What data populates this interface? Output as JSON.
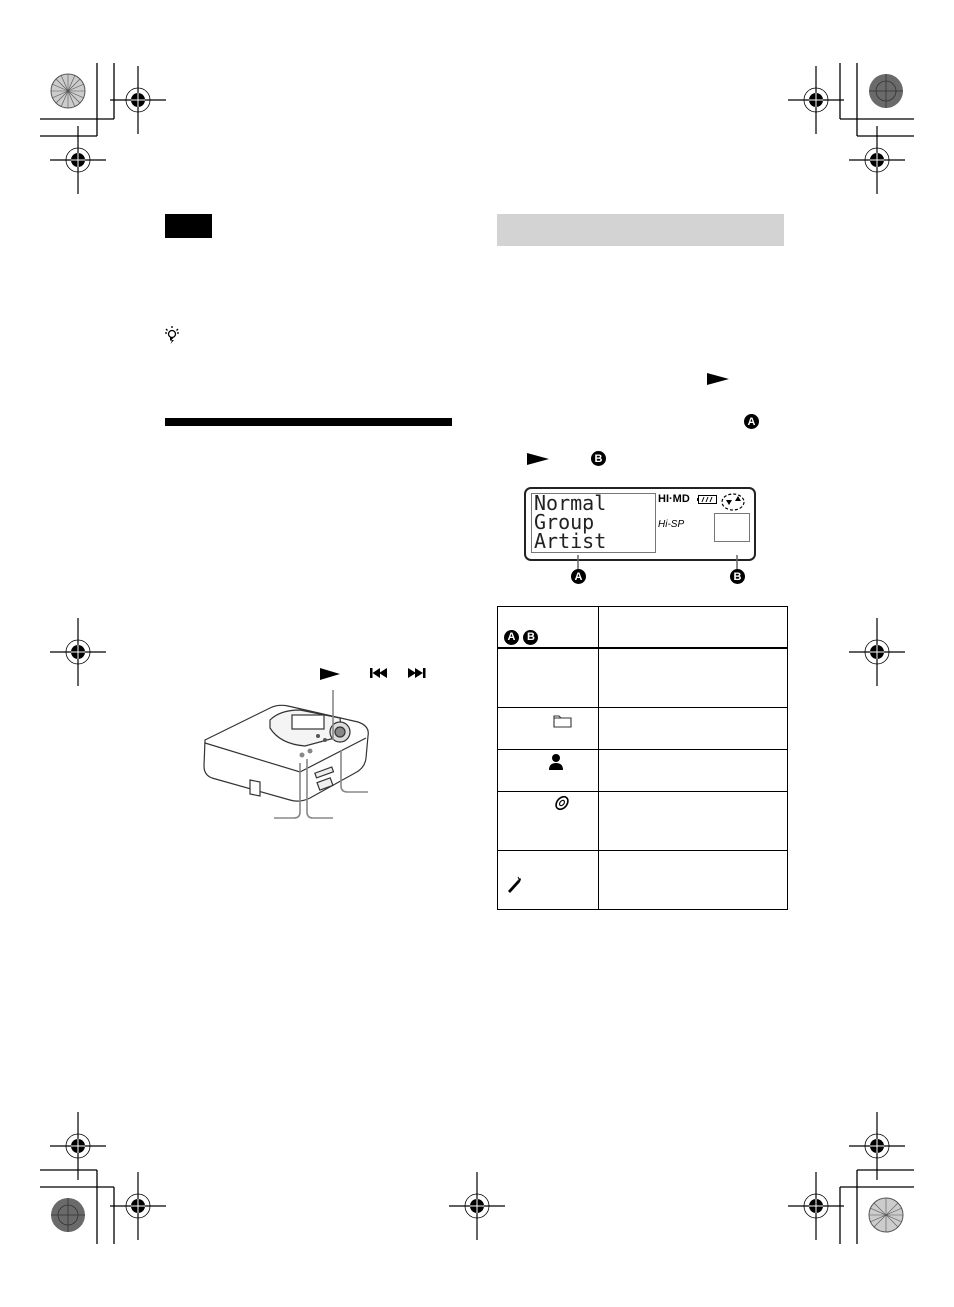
{
  "page": {
    "note_marker": "note-label-block",
    "tip_icon": "lightbulb-icon",
    "right_section": {
      "header": "",
      "play_symbol": "play-icon",
      "marker_a": "A",
      "marker_b": "B"
    },
    "lcd_display": {
      "lines": [
        "Normal",
        "Group",
        "Artist"
      ],
      "brand": "HI·MD",
      "mode": "Hi-SP",
      "callout_a": "A",
      "callout_b": "B"
    },
    "table": {
      "header_markers": [
        "A",
        "B"
      ],
      "rows": [
        {
          "icon": ""
        },
        {
          "icon": "folder-icon"
        },
        {
          "icon": "person-icon"
        },
        {
          "icon": "disc-icon"
        },
        {
          "icon": "pen-icon"
        }
      ]
    },
    "device_illustration": {
      "button_symbols": [
        "play",
        "previous",
        "next"
      ]
    }
  }
}
